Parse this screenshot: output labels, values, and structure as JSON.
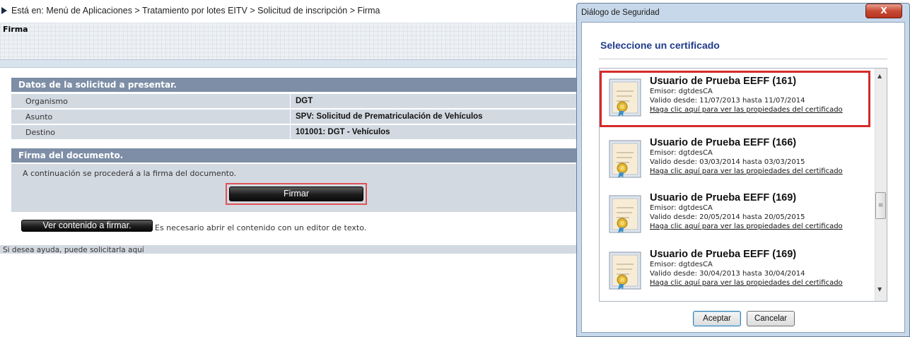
{
  "breadcrumb": "Está en: Menú de Aplicaciones > Tratamiento por lotes EITV > Solicitud de inscripción > Firma",
  "page_title": "Firma",
  "datos": {
    "header": "Datos de la solicitud a presentar.",
    "rows": [
      {
        "label": "Organismo",
        "value": "DGT"
      },
      {
        "label": "Asunto",
        "value": "SPV: Solicitud de Prematriculación de Vehículos"
      },
      {
        "label": "Destino",
        "value": "101001: DGT - Vehículos"
      }
    ]
  },
  "firma": {
    "header": "Firma del documento.",
    "text": "A continuación se procederá a la firma del documento.",
    "button": "Firmar"
  },
  "ver": {
    "button": "Ver contenido a firmar.",
    "note": "Es necesario abrir el contenido con un editor de texto."
  },
  "help_text": "Si desea ayuda, puede solicitarla aquí",
  "dialog": {
    "title": "Diálogo de Seguridad",
    "close": "X",
    "heading": "Seleccione un certificado",
    "certificates": [
      {
        "name": "Usuario de Prueba EEFF (161)",
        "emisor": "Emisor: dgtdesCA",
        "valido": "Valido desde: 11/07/2013 hasta 11/07/2014",
        "link": "Haga clic aquí para ver las propiedades del certificado"
      },
      {
        "name": "Usuario de Prueba EEFF (166)",
        "emisor": "Emisor: dgtdesCA",
        "valido": "Valido desde: 03/03/2014 hasta 03/03/2015",
        "link": "Haga clic aquí para ver las propiedades del certificado"
      },
      {
        "name": "Usuario de Prueba EEFF (169)",
        "emisor": "Emisor: dgtdesCA",
        "valido": "Valido desde: 20/05/2014 hasta 20/05/2015",
        "link": "Haga clic aquí para ver las propiedades del certificado"
      },
      {
        "name": "Usuario de Prueba EEFF (169)",
        "emisor": "Emisor: dgtdesCA",
        "valido": "Valido desde: 30/04/2013 hasta 30/04/2014",
        "link": "Haga clic aquí para ver las propiedades del certificado"
      }
    ],
    "ok": "Aceptar",
    "cancel": "Cancelar"
  },
  "colors": {
    "section_header": "#7d8ea6",
    "row_background": "#d3d9e1",
    "highlight": "#d42a2a",
    "heading_blue": "#1f3b8a"
  }
}
